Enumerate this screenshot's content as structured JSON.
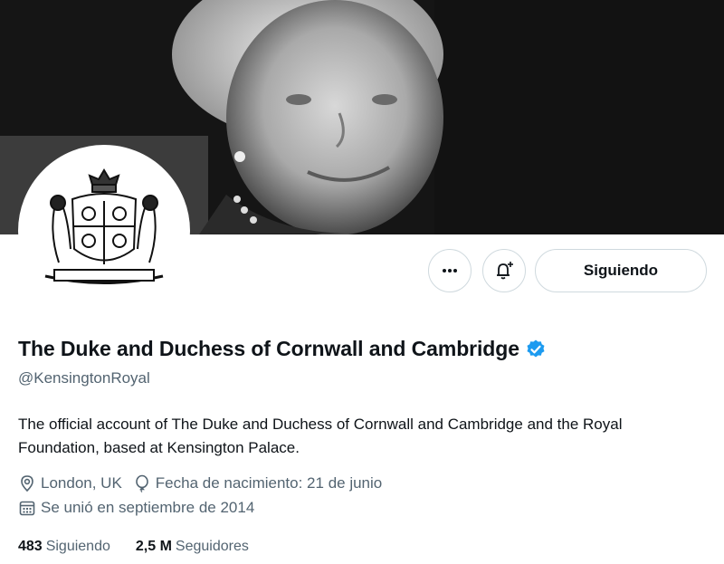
{
  "header": {
    "banner_image": "black-and-white-portrait",
    "avatar_image": "royal-coat-of-arms"
  },
  "actions": {
    "more_icon": "more-horizontal-icon",
    "notify_icon": "bell-plus-icon",
    "follow_label": "Siguiendo"
  },
  "profile": {
    "display_name": "The Duke and Duchess of Cornwall and Cambridge",
    "handle": "@KensingtonRoyal",
    "bio": "The official account of The Duke and Duchess of Cornwall and Cambridge and the Royal Foundation, based at Kensington Palace.",
    "location": "London, UK",
    "birthday": "Fecha de nacimiento: 21 de junio",
    "joined": "Se unió en septiembre de 2014"
  },
  "stats": {
    "following_count": "483",
    "following_label": "Siguiendo",
    "followers_count": "2,5 M",
    "followers_label": "Seguidores"
  },
  "colors": {
    "verified": "#1d9bf0",
    "muted_text": "#536471",
    "border": "#cfd9de"
  }
}
